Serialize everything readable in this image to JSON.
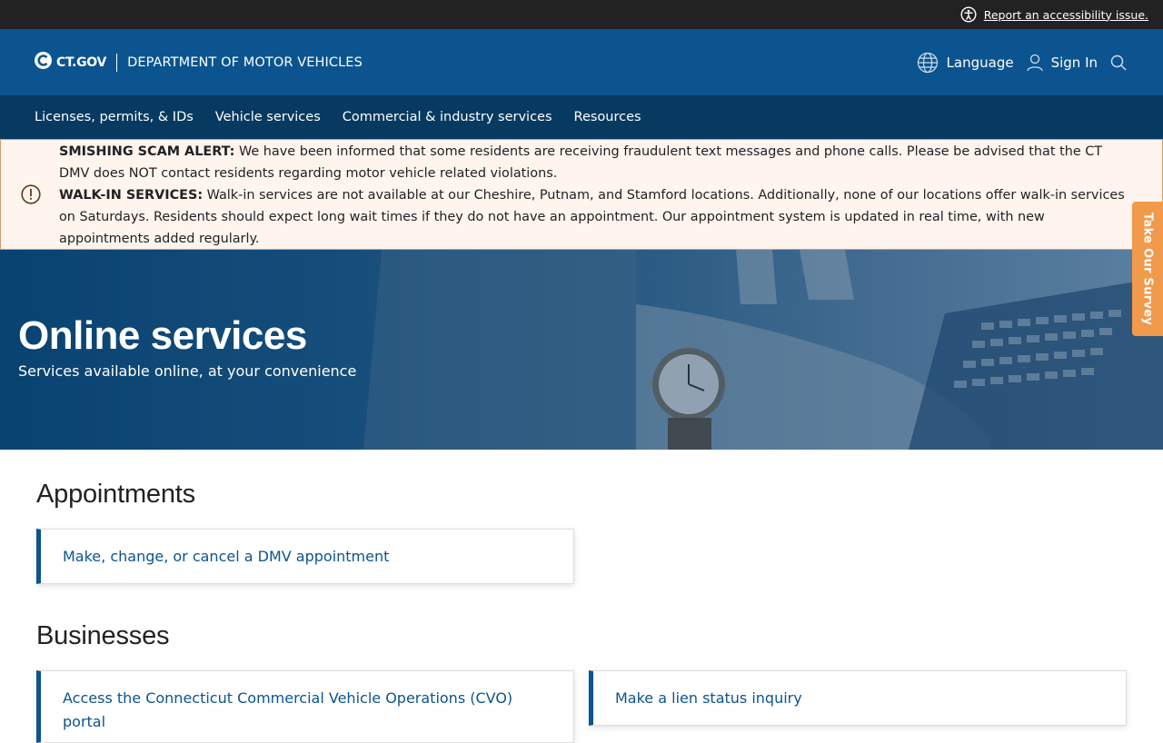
{
  "topbar": {
    "accessibility_link": "Report an accessibility issue."
  },
  "header": {
    "logo_text": "CT.GOV",
    "department": "DEPARTMENT OF MOTOR VEHICLES",
    "language_label": "Language",
    "signin_label": "Sign In"
  },
  "nav": {
    "items": [
      {
        "label": "Licenses, permits, & IDs"
      },
      {
        "label": "Vehicle services"
      },
      {
        "label": "Commercial & industry services"
      },
      {
        "label": "Resources"
      }
    ]
  },
  "alert": {
    "smishing_title": "SMISHING SCAM ALERT:",
    "smishing_text": " We have been informed that some residents are receiving fraudulent text messages and phone calls. Please be advised that the CT DMV does NOT contact residents regarding motor vehicle related violations.",
    "walkin_title": "WALK-IN SERVICES:",
    "walkin_text": " Walk-in services are not available at our Cheshire, Putnam, and Stamford locations. Additionally, none of our locations offer walk-in services on Saturdays. Residents should expect long wait times if they do not have an appointment. Our appointment system is updated in real time, with new appointments added regularly."
  },
  "survey": {
    "label": "Take Our Survey"
  },
  "hero": {
    "title": "Online services",
    "subtitle": "Services available online, at your convenience"
  },
  "sections": {
    "appointments": {
      "heading": "Appointments",
      "links": [
        {
          "label": "Make, change, or cancel a DMV appointment"
        }
      ]
    },
    "businesses": {
      "heading": "Businesses",
      "links": [
        {
          "label": "Access the Connecticut Commercial Vehicle Operations (CVO) portal"
        },
        {
          "label": "Make a lien status inquiry"
        }
      ]
    }
  },
  "colors": {
    "brand_blue": "#0b548f",
    "nav_blue": "#073a60",
    "alert_bg": "#fff4ee",
    "survey_orange": "#f19a4b"
  },
  "icons": [
    "accessibility-icon",
    "ct-logo-icon",
    "globe-icon",
    "user-icon",
    "search-icon",
    "alert-icon"
  ]
}
